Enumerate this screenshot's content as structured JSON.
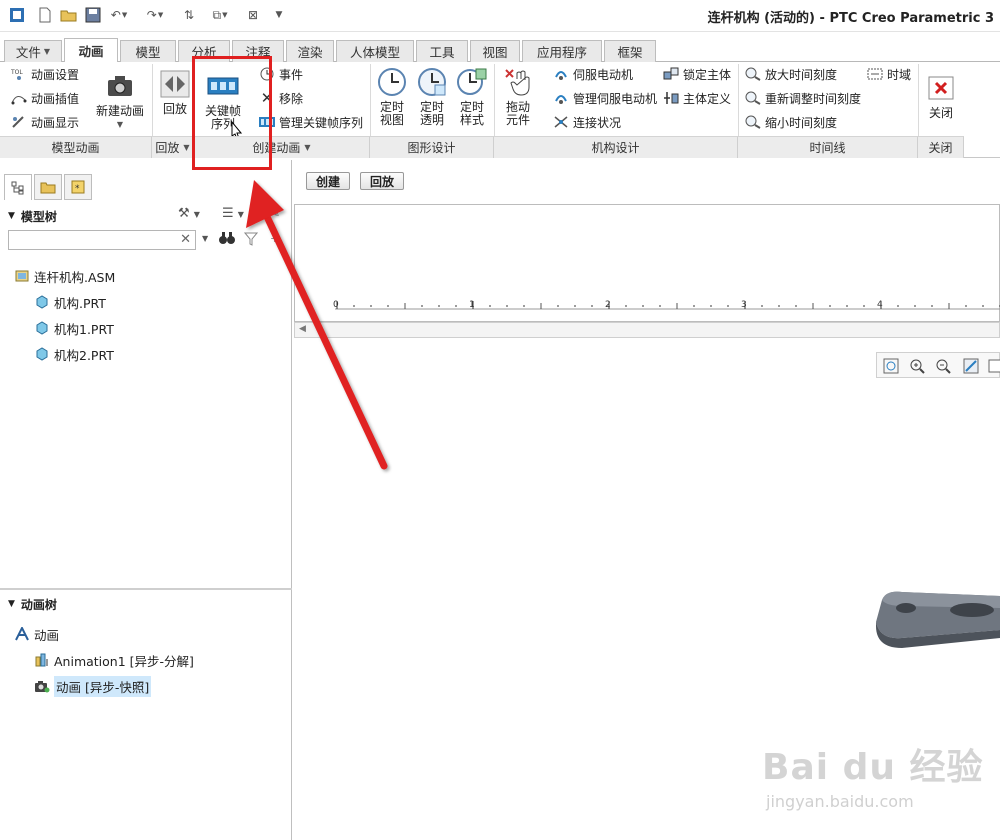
{
  "title": "连杆机构 (活动的) - PTC Creo Parametric 3",
  "quick_access": {
    "icons": [
      "app-icon",
      "new-icon",
      "open-icon",
      "save-icon",
      "undo-icon",
      "redo-icon",
      "regenerate-icon",
      "windows-icon",
      "close-window-icon",
      "customize-icon"
    ]
  },
  "tabs": [
    {
      "label": "文件",
      "has_arrow": true
    },
    {
      "label": "动画",
      "active": true
    },
    {
      "label": "模型"
    },
    {
      "label": "分析"
    },
    {
      "label": "注释"
    },
    {
      "label": "渲染"
    },
    {
      "label": "人体模型"
    },
    {
      "label": "工具"
    },
    {
      "label": "视图"
    },
    {
      "label": "应用程序"
    },
    {
      "label": "框架"
    }
  ],
  "ribbon": {
    "model_animation": {
      "items": [
        "动画设置",
        "动画插值",
        "动画显示"
      ],
      "new_animation": "新建动画",
      "footer": "模型动画"
    },
    "playback": {
      "button": "回放",
      "footer": "回放"
    },
    "create_animation": {
      "keyframe_line1": "关键帧",
      "keyframe_line2": "序列",
      "items": [
        "事件",
        "移除",
        "管理关键帧序列"
      ],
      "footer": "创建动画"
    },
    "graphic_design": {
      "buttons": [
        {
          "line1": "定时",
          "line2": "视图"
        },
        {
          "line1": "定时",
          "line2": "透明"
        },
        {
          "line1": "定时",
          "line2": "样式"
        }
      ],
      "footer": "图形设计"
    },
    "mechanism_design": {
      "drag": {
        "line1": "拖动",
        "line2": "元件"
      },
      "col1": [
        "伺服电动机",
        "管理伺服电动机",
        "连接状况"
      ],
      "col2": [
        "锁定主体",
        "主体定义"
      ],
      "footer": "机构设计"
    },
    "timeline": {
      "items": [
        "放大时间刻度",
        "重新调整时间刻度",
        "缩小时间刻度"
      ],
      "time_domain": "时域",
      "footer": "时间线"
    },
    "close": {
      "button": "关闭",
      "footer": "关闭"
    }
  },
  "panel_tabs": [
    "model-tree-tab",
    "folder-tab",
    "favorites-tab"
  ],
  "model_tree": {
    "header": "模型树",
    "search_placeholder": "",
    "items": [
      {
        "label": "连杆机构.ASM",
        "level": 0
      },
      {
        "label": "机构.PRT",
        "level": 1
      },
      {
        "label": "机构1.PRT",
        "level": 1
      },
      {
        "label": "机构2.PRT",
        "level": 1
      }
    ]
  },
  "animation_tree": {
    "header": "动画树",
    "items": [
      {
        "label": "动画",
        "level": 0
      },
      {
        "label": "Animation1 [异步-分解]",
        "level": 1
      },
      {
        "label": "动画 [异步-快照]",
        "level": 1,
        "selected": true
      }
    ]
  },
  "timeline_buttons": {
    "create": "创建",
    "playback": "回放"
  },
  "ruler": {
    "ticks": [
      "0",
      "1",
      "2",
      "3",
      "4"
    ]
  },
  "view_toolbar": {
    "icons": [
      "refit-icon",
      "zoom-in-icon",
      "zoom-out-icon",
      "repaint-icon",
      "saved-views-icon"
    ]
  },
  "watermark": {
    "main": "Bai du 经验",
    "sub": "jingyan.baidu.com"
  },
  "colors": {
    "highlight": "#e02020",
    "accent_blue": "#2a7fc1",
    "selection": "#cfe8fb"
  }
}
